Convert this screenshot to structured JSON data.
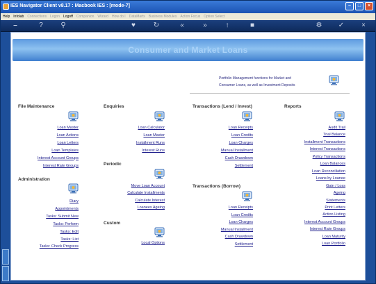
{
  "window": {
    "title": "IES Navigator Client v8.17 : Macbook IES :      [mode-7]"
  },
  "menubar": {
    "items": [
      {
        "label": "Help",
        "dim": false
      },
      {
        "label": "Infolab",
        "dim": false
      },
      {
        "label": "Connections",
        "dim": true
      },
      {
        "label": "Logon",
        "dim": true
      },
      {
        "label": "Logoff",
        "dim": false
      },
      {
        "label": "Companion",
        "dim": true
      },
      {
        "label": "Wizard",
        "dim": true
      },
      {
        "label": "How do I",
        "dim": true
      },
      {
        "label": "DataMarts",
        "dim": true
      },
      {
        "label": "Business Modules",
        "dim": true
      },
      {
        "label": "Action Focus",
        "dim": true
      },
      {
        "label": "Option Select",
        "dim": true
      }
    ]
  },
  "banner": {
    "title": "Consumer and Market Loans"
  },
  "blurb": {
    "line1": "Portfolio Management functions for Market and",
    "line2": "Consumer Loans, as well as Investment Deposits"
  },
  "sections": {
    "file_maintenance": {
      "heading": "File Maintenance",
      "links": [
        "Loan Master",
        "Loan Actions",
        "Loan Letters",
        "Loan Templates",
        "Interest Account Groups",
        "Interest Rate Groups"
      ]
    },
    "administration": {
      "heading": "Administration",
      "links": [
        "Diary",
        "Appointments",
        "Tasks: Submit New",
        "Tasks: Perform",
        "Tasks: Edit",
        "Tasks: List",
        "Tasks: Check Progress"
      ]
    },
    "enquiries": {
      "heading": "Enquiries",
      "links": [
        "Loan Calculator",
        "Loan Master",
        "Installment Runs",
        "Interest Runs"
      ]
    },
    "periodic": {
      "heading": "Periodic",
      "links": [
        "Move Loan Account",
        "Calculate Installments",
        "Calculate Interest",
        "Loanees Ageing"
      ]
    },
    "custom": {
      "heading": "Custom",
      "links": [
        "Local Options"
      ]
    },
    "trans_lend": {
      "heading": "Transactions (Lend / Invest)",
      "links": [
        "Loan Receipts",
        "Loan Credits",
        "Loan Charges",
        "Manual Installment",
        "Cash Drawdown",
        "Settlement"
      ]
    },
    "trans_borrow": {
      "heading": "Transactions (Borrow)",
      "links": [
        "Loan Receipts",
        "Loan Credits",
        "Loan Charges",
        "Manual Installment",
        "Cash Drawdown",
        "Settlement"
      ]
    },
    "reports": {
      "heading": "Reports",
      "links": [
        "Audit Trail",
        "Trial Balance",
        "Installment Transactions",
        "Interest Transactions",
        "Policy Transactions",
        "Loan Balances",
        "Loan Reconciliation",
        "Loans by Loanee",
        "Gain / Loss",
        "Ageing",
        "Statements",
        "Print Letters",
        "Action Listing",
        "Interest Account Groups",
        "Interest Rate Groups",
        "Loan Maturity",
        "Loan Portfolio"
      ]
    }
  }
}
